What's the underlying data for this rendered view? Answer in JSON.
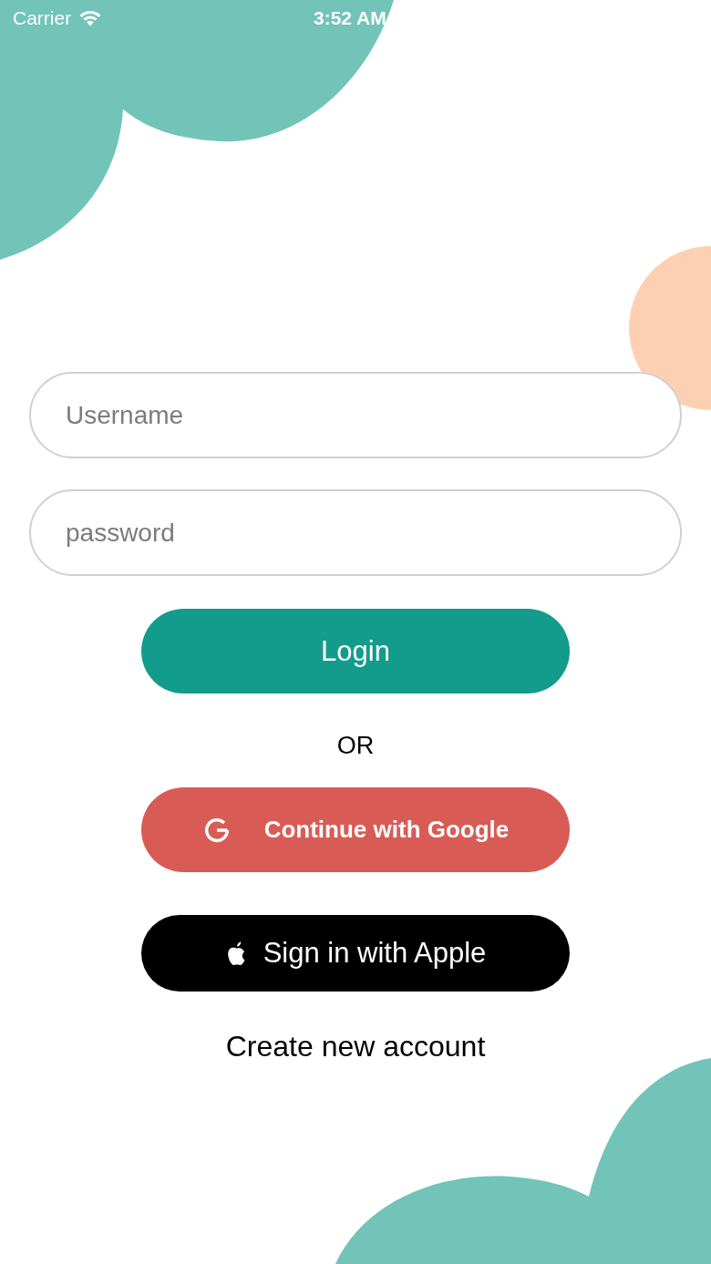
{
  "status_bar": {
    "carrier": "Carrier",
    "time": "3:52 AM"
  },
  "username": {
    "placeholder": "Username"
  },
  "password": {
    "placeholder": "password"
  },
  "login_button": "Login",
  "separator": "OR",
  "social_buttons": [
    {
      "kind": "google",
      "label": "Continue with Google"
    },
    {
      "kind": "apple",
      "label": "Sign in with Apple"
    }
  ],
  "create_account_link": "Create new account"
}
